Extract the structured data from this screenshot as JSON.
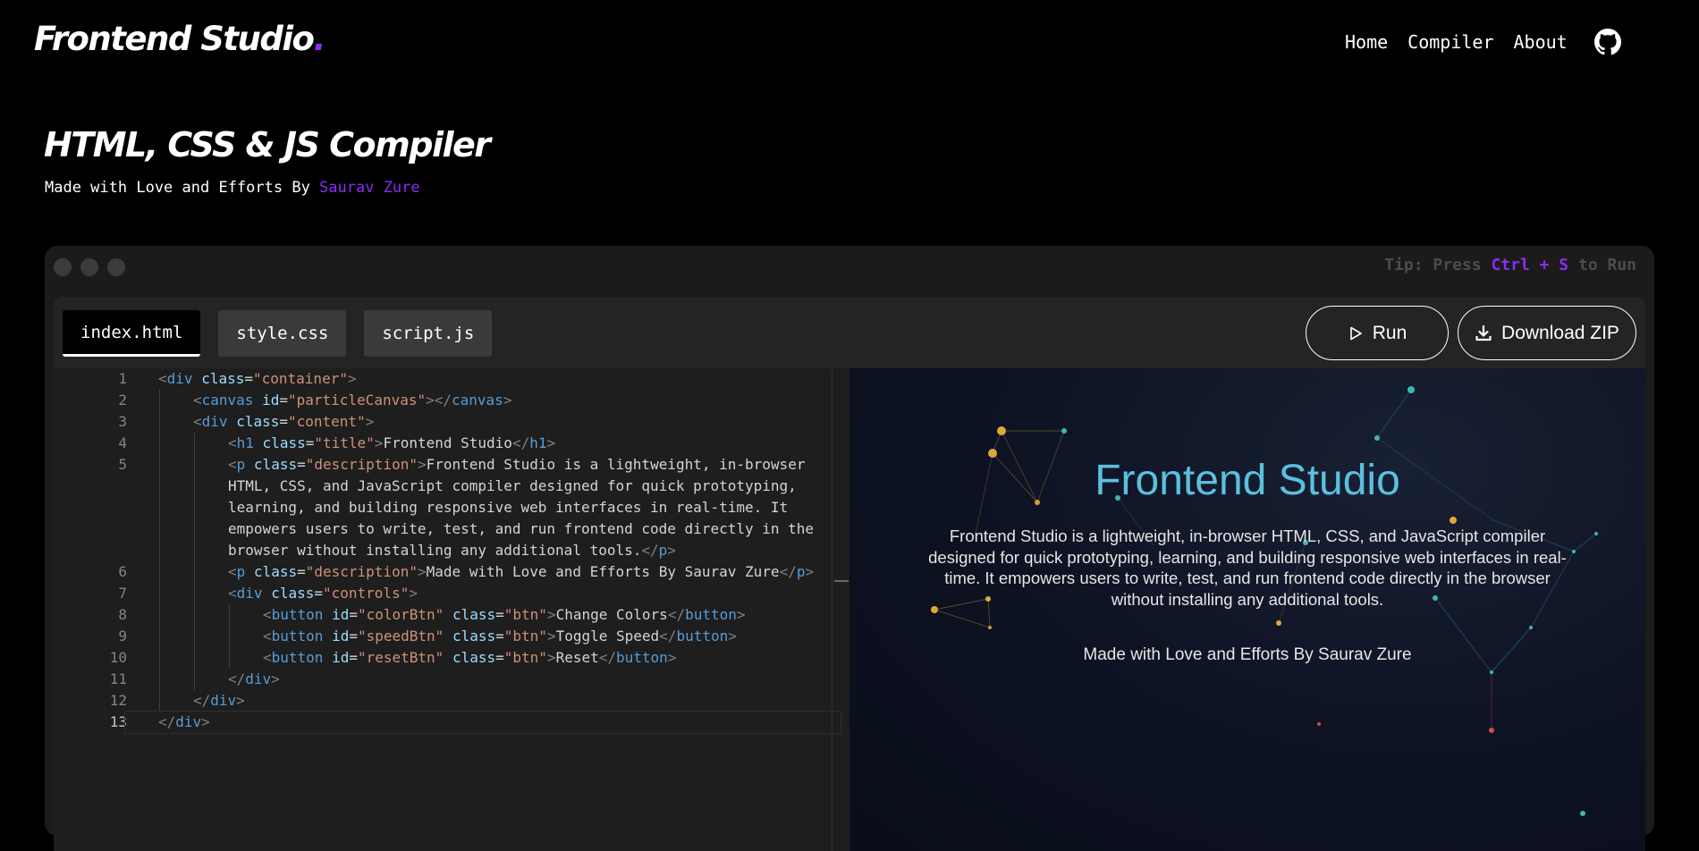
{
  "brand": {
    "name": "Frontend Studio",
    "dot": "."
  },
  "nav": {
    "home": "Home",
    "compiler": "Compiler",
    "about": "About",
    "github_icon": "github-icon"
  },
  "hero": {
    "title": "HTML, CSS & JS Compiler",
    "subtitle_prefix": "Made with Love and Efforts By ",
    "author": "Saurav Zure"
  },
  "window": {
    "tip_prefix": "Tip: Press ",
    "tip_keys": "Ctrl + S",
    "tip_suffix": " to Run"
  },
  "tabs": [
    {
      "label": "index.html",
      "active": true
    },
    {
      "label": "style.css",
      "active": false
    },
    {
      "label": "script.js",
      "active": false
    }
  ],
  "actions": {
    "run": "Run",
    "download": "Download ZIP"
  },
  "editor": {
    "line_numbers": [
      "1",
      "2",
      "3",
      "4",
      "5",
      "6",
      "7",
      "8",
      "9",
      "10",
      "11",
      "12",
      "13"
    ],
    "current_line": "13",
    "lines": [
      {
        "indent": 1,
        "code": "<div class=\"container\">"
      },
      {
        "indent": 2,
        "code": "<canvas id=\"particleCanvas\"></canvas>"
      },
      {
        "indent": 2,
        "code": "<div class=\"content\">"
      },
      {
        "indent": 3,
        "code": "<h1 class=\"title\">Frontend Studio</h1>"
      },
      {
        "indent": 3,
        "code": "<p class=\"description\">Frontend Studio is a lightweight, in-browser HTML, CSS, and JavaScript compiler designed for quick prototyping, learning, and building responsive web interfaces in real-time. It empowers users to write, test, and run frontend code directly in the browser without installing any additional tools.</p>"
      },
      {
        "indent": 3,
        "code": "<p class=\"description\">Made with Love and Efforts By Saurav Zure</p>"
      },
      {
        "indent": 3,
        "code": "<div class=\"controls\">"
      },
      {
        "indent": 4,
        "code": "<button id=\"colorBtn\" class=\"btn\">Change Colors</button>"
      },
      {
        "indent": 4,
        "code": "<button id=\"speedBtn\" class=\"btn\">Toggle Speed</button>"
      },
      {
        "indent": 4,
        "code": "<button id=\"resetBtn\" class=\"btn\">Reset</button>"
      },
      {
        "indent": 3,
        "code": "</div>"
      },
      {
        "indent": 2,
        "code": "</div>"
      },
      {
        "indent": 1,
        "code": "</div>"
      }
    ]
  },
  "preview": {
    "title": "Frontend Studio",
    "description": "Frontend Studio is a lightweight, in-browser HTML, CSS, and JavaScript compiler designed for quick prototyping, learning, and building responsive web interfaces in real-time. It empowers users to write, test, and run frontend code directly in the browser without installing any additional tools.",
    "credit": "Made with Love and Efforts By Saurav Zure"
  },
  "colors": {
    "accent": "#8b2cf5",
    "background": "#000000",
    "preview_title": "#5bc0de",
    "tag": "#569cd6",
    "attr": "#9cdcfe",
    "string": "#ce9178"
  }
}
